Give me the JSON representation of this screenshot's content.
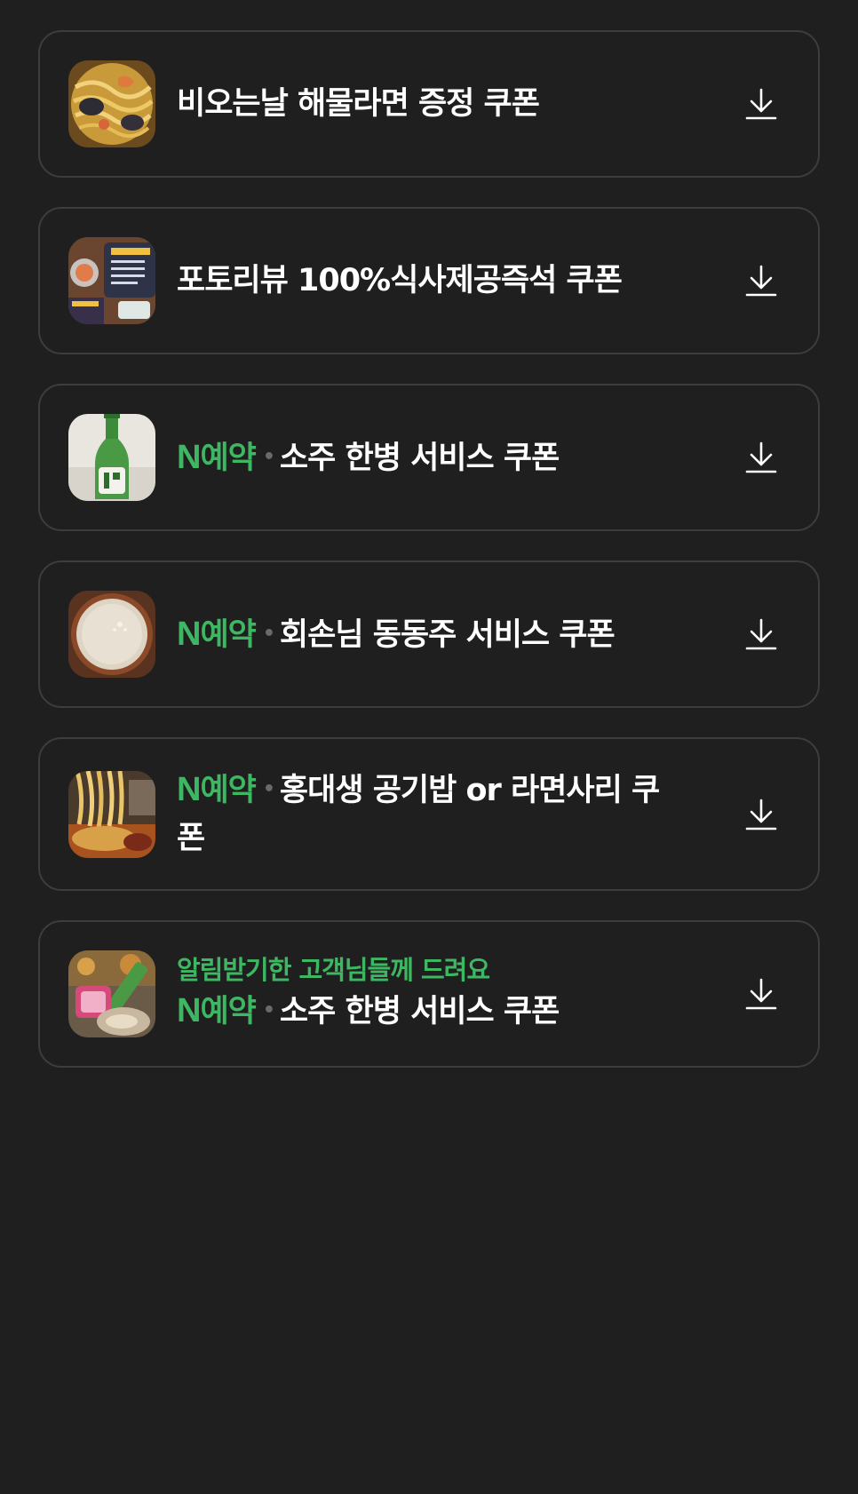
{
  "coupons": [
    {
      "title": "비오는날 해물라면 증정 쿠폰",
      "has_nbadge": false,
      "subtitle": "",
      "thumbnail_icon": "seafood-ramen-photo"
    },
    {
      "title": "포토리뷰 100%식사제공즉석 쿠폰",
      "has_nbadge": false,
      "subtitle": "",
      "thumbnail_icon": "review-event-poster"
    },
    {
      "title": "소주 한병 서비스 쿠폰",
      "has_nbadge": true,
      "badge_label": "N예약",
      "subtitle": "",
      "thumbnail_icon": "soju-bottle-photo"
    },
    {
      "title": "회손님 동동주 서비스 쿠폰",
      "has_nbadge": true,
      "badge_label": "N예약",
      "subtitle": "",
      "thumbnail_icon": "dongdongju-bowl-photo"
    },
    {
      "title_line1": "홍대생 공기밥 or 라면사리 쿠",
      "title_line2": "폰",
      "has_nbadge": true,
      "badge_label": "N예약",
      "subtitle": "",
      "thumbnail_icon": "ramen-noodles-photo"
    },
    {
      "title": "소주 한병 서비스 쿠폰",
      "has_nbadge": true,
      "badge_label": "N예약",
      "subtitle": "알림받기한 고객님들께 드려요",
      "thumbnail_icon": "soju-and-food-photo"
    }
  ],
  "colors": {
    "background": "#1f1f20",
    "card_border": "#3d3d3f",
    "naver_green": "#3eb762",
    "text": "#ffffff"
  },
  "icons": {
    "download": "download-icon"
  }
}
